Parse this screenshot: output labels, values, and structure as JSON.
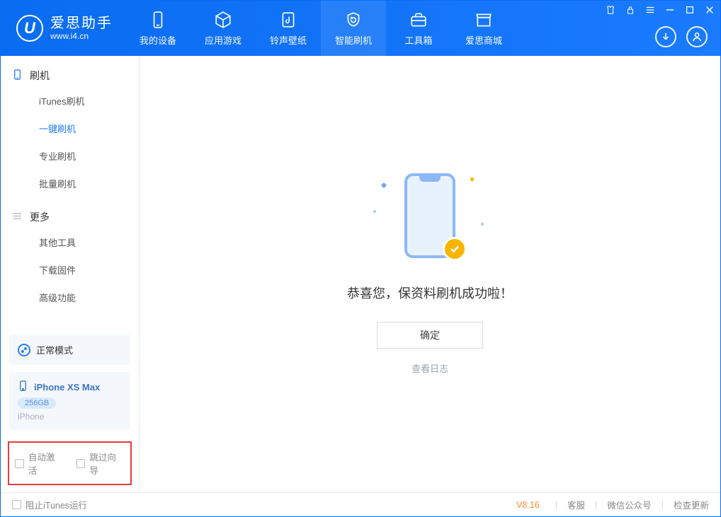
{
  "brand": {
    "cn": "爱思助手",
    "en": "www.i4.cn"
  },
  "nav": {
    "items": [
      {
        "label": "我的设备"
      },
      {
        "label": "应用游戏"
      },
      {
        "label": "铃声壁纸"
      },
      {
        "label": "智能刷机"
      },
      {
        "label": "工具箱"
      },
      {
        "label": "爱思商城"
      }
    ]
  },
  "sidebar": {
    "group1_title": "刷机",
    "group1": [
      {
        "label": "iTunes刷机"
      },
      {
        "label": "一键刷机"
      },
      {
        "label": "专业刷机"
      },
      {
        "label": "批量刷机"
      }
    ],
    "group2_title": "更多",
    "group2": [
      {
        "label": "其他工具"
      },
      {
        "label": "下载固件"
      },
      {
        "label": "高级功能"
      }
    ],
    "mode_label": "正常模式",
    "device": {
      "name": "iPhone XS Max",
      "storage": "256GB",
      "type": "iPhone"
    },
    "chk_auto_activate": "自动激活",
    "chk_skip_guide": "跳过向导"
  },
  "main": {
    "success_msg": "恭喜您，保资料刷机成功啦！",
    "ok_btn": "确定",
    "log_link": "查看日志"
  },
  "footer": {
    "block_itunes": "阻止iTunes运行",
    "version": "V8.16",
    "links": [
      "客服",
      "微信公众号",
      "检查更新"
    ]
  }
}
